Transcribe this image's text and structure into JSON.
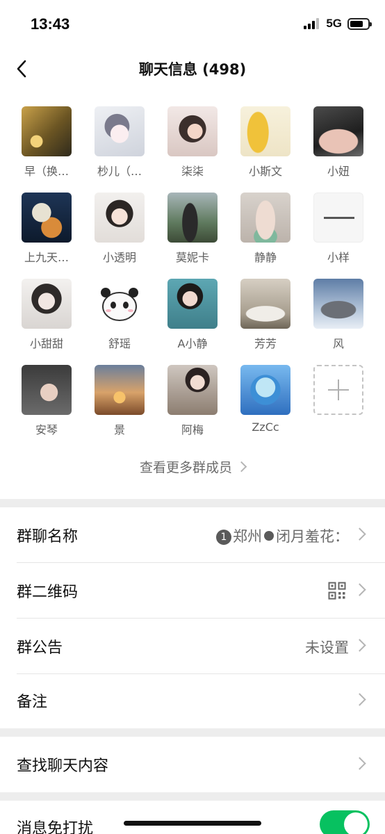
{
  "status": {
    "time": "13:43",
    "network": "5G"
  },
  "header": {
    "title": "聊天信息 (498)"
  },
  "members": [
    {
      "name": "早（换…"
    },
    {
      "name": "杪儿（…"
    },
    {
      "name": "柒柒"
    },
    {
      "name": "小斯文"
    },
    {
      "name": "小妞"
    },
    {
      "name": "上九天…"
    },
    {
      "name": "小透明"
    },
    {
      "name": "莫妮卡"
    },
    {
      "name": "静静"
    },
    {
      "name": "小样"
    },
    {
      "name": "小甜甜"
    },
    {
      "name": "舒瑶"
    },
    {
      "name": "A小静"
    },
    {
      "name": "芳芳"
    },
    {
      "name": "风"
    },
    {
      "name": "安琴"
    },
    {
      "name": "景"
    },
    {
      "name": "阿梅"
    },
    {
      "name": "ZzCc"
    }
  ],
  "more_members": "查看更多群成员",
  "settings": {
    "group_name": {
      "label": "群聊名称",
      "badge": "1",
      "value_a": "郑州",
      "value_b": "闭月羞花："
    },
    "qr_code": {
      "label": "群二维码"
    },
    "announcement": {
      "label": "群公告",
      "value": "未设置"
    },
    "remark": {
      "label": "备注"
    },
    "search_history": {
      "label": "查找聊天内容"
    },
    "mute": {
      "label": "消息免打扰",
      "enabled": true
    }
  },
  "colors": {
    "accent": "#07c160",
    "background": "#ededed"
  }
}
